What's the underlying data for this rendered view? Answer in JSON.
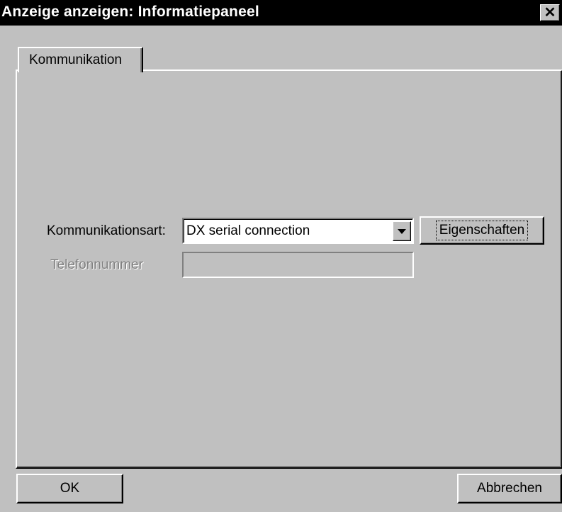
{
  "window": {
    "title": "Anzeige anzeigen: Informatiepaneel",
    "close_glyph": "✕"
  },
  "tabs": [
    {
      "label": "Kommunikation",
      "selected": true
    }
  ],
  "form": {
    "comm_type_label": "Kommunikationsart:",
    "comm_type_value": "DX serial connection",
    "properties_button": "Eigenschaften",
    "phone_label": "Telefonnummer",
    "phone_value": "",
    "phone_enabled": false
  },
  "buttons": {
    "ok": "OK",
    "cancel": "Abbrechen"
  },
  "colors": {
    "titlebar": "#000000",
    "face": "#c0c0c0",
    "disabled_text": "#808080"
  },
  "icons": {
    "close": "close-icon",
    "dropdown": "chevron-down-icon"
  }
}
